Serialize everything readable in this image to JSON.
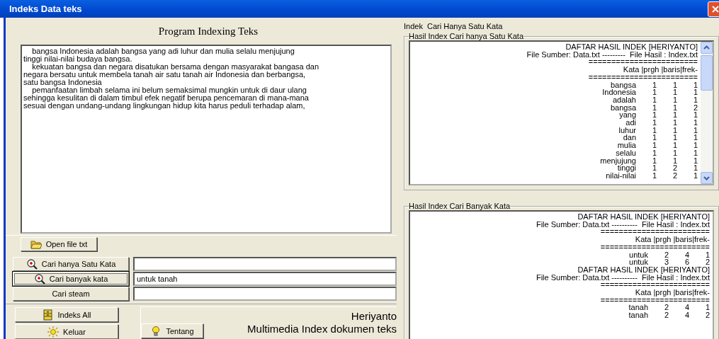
{
  "window": {
    "title": "Indeks Data teks"
  },
  "editor": {
    "heading": "Program Indexing Teks",
    "lines": [
      "    bangsa Indonesia adalah bangsa yang adi luhur dan mulia selalu menjujung",
      "tinggi nilai-nilai budaya bangsa.",
      "    kekuatan bangsa dan negara disatukan bersama dengan masyarakat bangasa dan",
      "negara bersatu untuk membela tanah air satu tanah air Indonesia dan berbangsa,",
      "satu bangsa Indonesia",
      "    pemanfaatan limbah selama ini belum semaksimal mungkin untuk di daur ulang",
      "sehingga kesulitan di dalam timbul efek negatif berupa pencemaran di mana-mana",
      "sesuai dengan undang-undang lingkungan hidup kita harus peduli terhadap alam,"
    ]
  },
  "open_button": {
    "label": "Open file txt"
  },
  "searches": [
    {
      "label": "Cari hanya Satu Kata",
      "kind": "magnifier",
      "focused": false
    },
    {
      "label": "Cari banyak kata",
      "kind": "magnifier",
      "focused": true,
      "value": "untuk tanah"
    },
    {
      "label": "Cari steam",
      "kind": "plain",
      "focused": false
    }
  ],
  "bottom_buttons": [
    {
      "label": "Indeks All",
      "kind": "cabinet"
    },
    {
      "label": "Keluar",
      "kind": "sun"
    }
  ],
  "about_button": {
    "label": "Tentang"
  },
  "credits": [
    "Heriyanto",
    "Multimedia Index dokumen teks"
  ],
  "mode_label": "Indek  Cari Hanya Satu Kata",
  "results": [
    {
      "title": "Hasil Index Cari hanya Satu Kata",
      "scrollbar": true,
      "lines": [
        {
          "kind": "text",
          "text": "DAFTAR HASIL INDEK [HERIYANTO]"
        },
        {
          "kind": "text",
          "text": "File Sumber: Data.txt ---------  File Hasil : Index.txt"
        },
        {
          "kind": "text",
          "text": "========================"
        },
        {
          "kind": "text",
          "text": "Kata |prgh |baris|frek-"
        },
        {
          "kind": "text",
          "text": "========================"
        },
        {
          "kind": "row",
          "cells": [
            "bangsa",
            "1",
            "1",
            "1"
          ]
        },
        {
          "kind": "row",
          "cells": [
            "Indonesia",
            "1",
            "1",
            "1"
          ]
        },
        {
          "kind": "row",
          "cells": [
            "adalah",
            "1",
            "1",
            "1"
          ]
        },
        {
          "kind": "row",
          "cells": [
            "bangsa",
            "1",
            "1",
            "2"
          ]
        },
        {
          "kind": "row",
          "cells": [
            "yang",
            "1",
            "1",
            "1"
          ]
        },
        {
          "kind": "row",
          "cells": [
            "adi",
            "1",
            "1",
            "1"
          ]
        },
        {
          "kind": "row",
          "cells": [
            "luhur",
            "1",
            "1",
            "1"
          ]
        },
        {
          "kind": "row",
          "cells": [
            "dan",
            "1",
            "1",
            "1"
          ]
        },
        {
          "kind": "row",
          "cells": [
            "mulia",
            "1",
            "1",
            "1"
          ]
        },
        {
          "kind": "row",
          "cells": [
            "selalu",
            "1",
            "1",
            "1"
          ]
        },
        {
          "kind": "row",
          "cells": [
            "menjujung",
            "1",
            "1",
            "1"
          ]
        },
        {
          "kind": "row",
          "cells": [
            "tinggi",
            "1",
            "2",
            "1"
          ]
        },
        {
          "kind": "row",
          "cells": [
            "nilai-nilai",
            "1",
            "2",
            "1"
          ]
        }
      ]
    },
    {
      "title": "Hasil Index Cari Banyak Kata",
      "scrollbar": false,
      "lines": [
        {
          "kind": "text",
          "text": "DAFTAR HASIL INDEK [HERIYANTO]"
        },
        {
          "kind": "text",
          "text": "File Sumber: Data.txt ----------  File Hasil : Index.txt"
        },
        {
          "kind": "text",
          "text": "========================"
        },
        {
          "kind": "text",
          "text": "Kata |prgh |baris|frek-"
        },
        {
          "kind": "text",
          "text": "========================"
        },
        {
          "kind": "row",
          "cells": [
            "untuk",
            "2",
            "4",
            "1"
          ]
        },
        {
          "kind": "row",
          "cells": [
            "untuk",
            "3",
            "6",
            "2"
          ]
        },
        {
          "kind": "text",
          "text": "DAFTAR HASIL INDEK [HERIYANTO]"
        },
        {
          "kind": "text",
          "text": "File Sumber: Data.txt ----------  File Hasil : Index.txt"
        },
        {
          "kind": "text",
          "text": "========================"
        },
        {
          "kind": "text",
          "text": "Kata |prgh |baris|frek-"
        },
        {
          "kind": "text",
          "text": "========================"
        },
        {
          "kind": "row",
          "cells": [
            "tanah",
            "2",
            "4",
            "1"
          ]
        },
        {
          "kind": "row",
          "cells": [
            "tanah",
            "2",
            "4",
            "2"
          ]
        }
      ]
    }
  ]
}
